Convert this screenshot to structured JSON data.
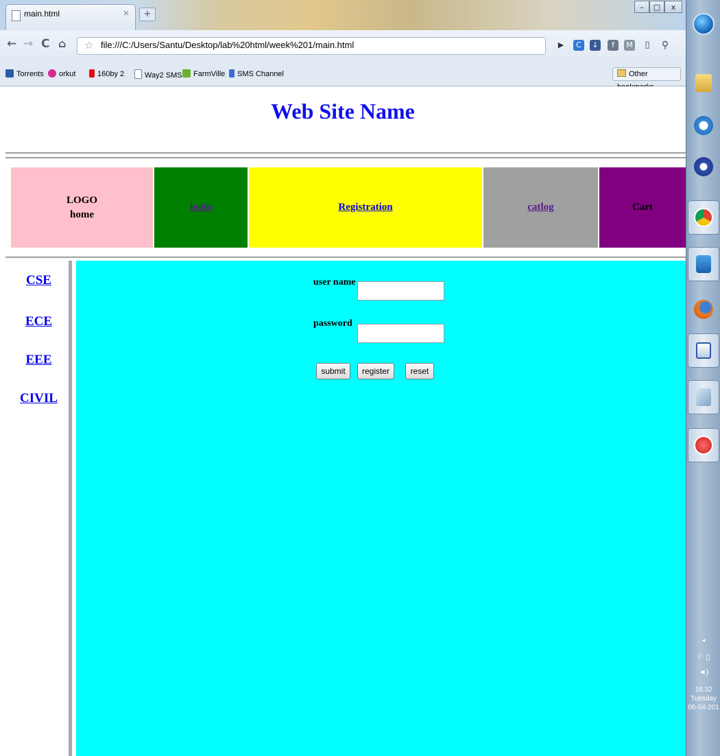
{
  "browser": {
    "tab_title": "main.html",
    "tab_close": "×",
    "new_tab": "+",
    "url": "file:///C:/Users/Santu/Desktop/lab%20html/week%201/main.html",
    "bookmarks": [
      {
        "label": "Torrents",
        "icon": "torrents-icon",
        "color": "#2b5aa8"
      },
      {
        "label": "orkut",
        "icon": "orkut-icon",
        "color": "#d6288f"
      },
      {
        "label": "160by 2",
        "icon": "160by2-icon",
        "color": "#e01010"
      },
      {
        "label": "Way2 SMS",
        "icon": "page-icon",
        "color": "#ffffff"
      },
      {
        "label": "FarmVille",
        "icon": "farmville-icon",
        "color": "#6bb02e"
      },
      {
        "label": "SMS Channel",
        "icon": "smschannel-icon",
        "color": "#3b6fd0"
      }
    ],
    "other_bookmarks": "Other bookmarks"
  },
  "site": {
    "title": "Web Site Name",
    "nav": {
      "logo": "LOGO",
      "home": "home",
      "login": "login",
      "registration": "Registration",
      "catlog": "catlog",
      "cart": "Cart"
    },
    "colors": {
      "logo_cell": "#ffc0cb",
      "login_cell": "#008000",
      "registration_cell": "#ffff00",
      "catlog_cell": "#a0a0a0",
      "cart_cell": "#800080",
      "content_bg": "#00ffff",
      "title": "#1111ee"
    },
    "sidebar": [
      "CSE",
      "ECE",
      "EEE",
      "CIVIL"
    ],
    "form": {
      "username_label": "user name",
      "password_label": "password",
      "submit": "submit",
      "register": "register",
      "reset": "reset"
    }
  },
  "taskbar": {
    "time": "16:32",
    "day": "Tuesday",
    "date": "06-04-201"
  }
}
